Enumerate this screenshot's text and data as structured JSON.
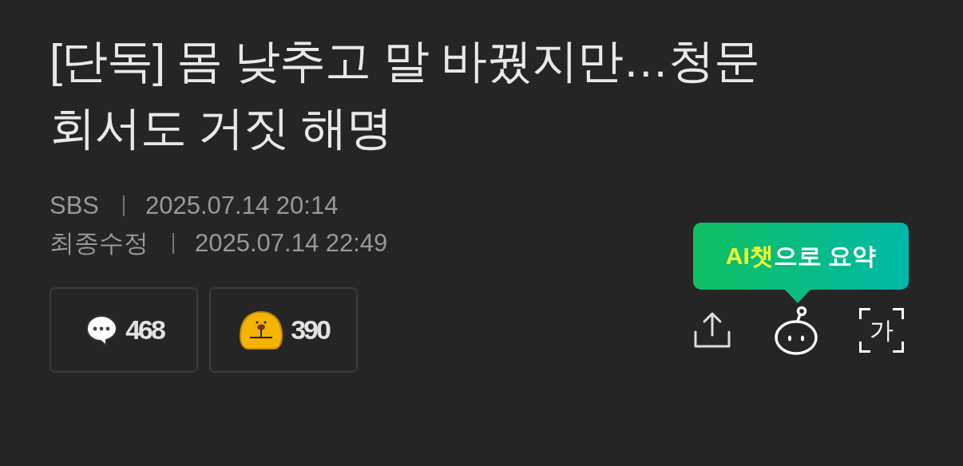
{
  "headline": {
    "lines": [
      "[단독] 몸 낮추고 말 바꿨지만…청문",
      "회서도 거짓 해명"
    ]
  },
  "meta": [
    {
      "label": "SBS",
      "date": "2025.07.14 20:14"
    },
    {
      "label": "최종수정",
      "date": "2025.07.14 22:49"
    }
  ],
  "reactions": [
    {
      "kind": "comments",
      "count": "468"
    },
    {
      "kind": "likes",
      "count": "390"
    }
  ],
  "tooltip": {
    "highlight": "AI챗",
    "text": "으로 요약"
  },
  "tools": [
    {
      "kind": "share"
    },
    {
      "kind": "ai"
    },
    {
      "kind": "font",
      "glyph": "가"
    }
  ]
}
